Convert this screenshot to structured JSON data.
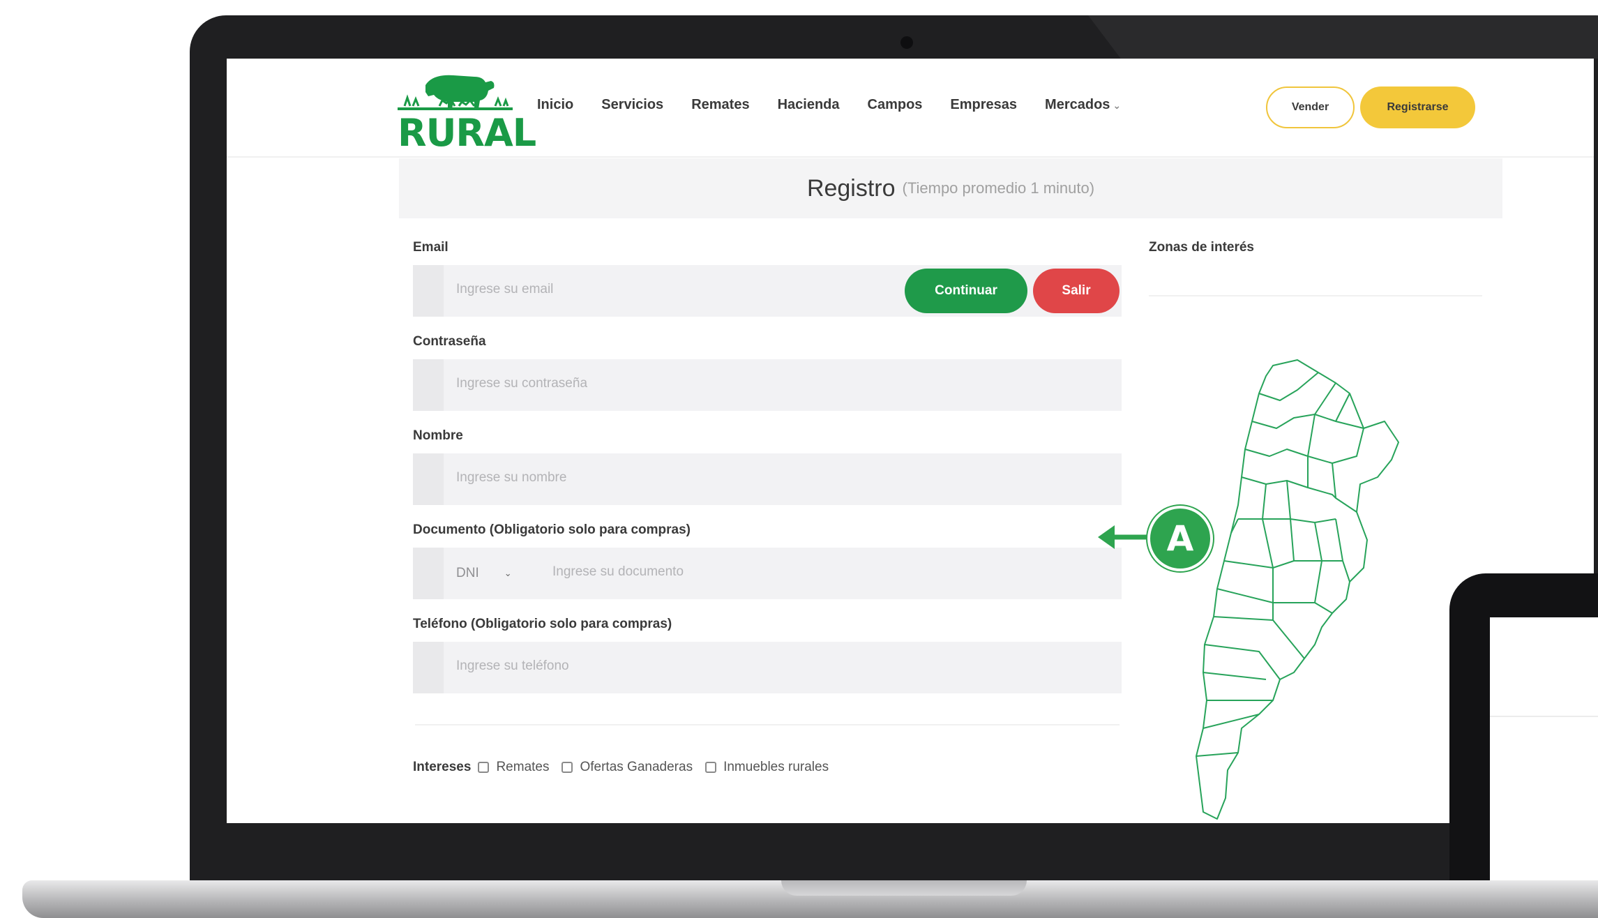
{
  "brand": {
    "name": "RURAL",
    "color": "#1a9a46"
  },
  "nav": {
    "items": [
      "Inicio",
      "Servicios",
      "Remates",
      "Hacienda",
      "Campos",
      "Empresas",
      "Mercados"
    ],
    "dropdown_icon": "chevron-down-icon",
    "vender_label": "Vender",
    "registrarse_label": "Registrarse"
  },
  "page": {
    "title": "Registro",
    "subtitle": "(Tiempo promedio 1 minuto)"
  },
  "form": {
    "email": {
      "label": "Email",
      "placeholder": "Ingrese su email"
    },
    "continuar_label": "Continuar",
    "salir_label": "Salir",
    "password": {
      "label": "Contraseña",
      "placeholder": "Ingrese su contraseña"
    },
    "name": {
      "label": "Nombre",
      "placeholder": "Ingrese su nombre"
    },
    "document": {
      "label": "Documento (Obligatorio solo para compras)",
      "type_value": "DNI",
      "placeholder": "Ingrese su documento"
    },
    "phone": {
      "label": "Teléfono (Obligatorio solo para compras)",
      "placeholder": "Ingrese su teléfono"
    },
    "interests": {
      "label": "Intereses",
      "options": [
        "Remates",
        "Ofertas Ganaderas",
        "Inmuebles rurales"
      ]
    }
  },
  "zones": {
    "label": "Zonas de interés",
    "map_icon": "argentina-map"
  },
  "annotation": {
    "letter": "A"
  },
  "colors": {
    "accent_yellow": "#f3c83a",
    "continue_green": "#1f9a4a",
    "exit_red": "#e04648",
    "annotation_green": "#2ea44f"
  }
}
